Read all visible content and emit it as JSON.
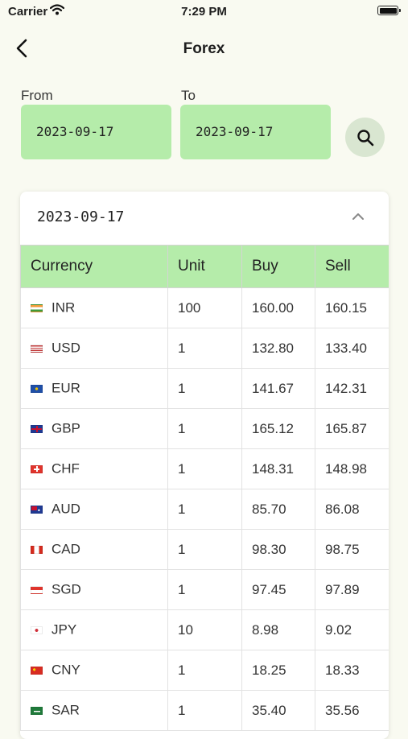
{
  "status": {
    "carrier": "Carrier",
    "time": "7:29 PM"
  },
  "nav": {
    "title": "Forex",
    "back_icon": "chevron-left-icon"
  },
  "filters": {
    "from_label": "From",
    "from_value": "2023-09-17",
    "to_label": "To",
    "to_value": "2023-09-17",
    "search_icon": "search-icon"
  },
  "card": {
    "date": "2023-09-17",
    "collapse_icon": "chevron-up-icon",
    "headers": [
      "Currency",
      "Unit",
      "Buy",
      "Sell"
    ],
    "rows": [
      {
        "code": "INR",
        "unit": "100",
        "buy": "160.00",
        "sell": "160.15",
        "flag": "india-flag-icon"
      },
      {
        "code": "USD",
        "unit": "1",
        "buy": "132.80",
        "sell": "133.40",
        "flag": "usa-flag-icon"
      },
      {
        "code": "EUR",
        "unit": "1",
        "buy": "141.67",
        "sell": "142.31",
        "flag": "eu-flag-icon"
      },
      {
        "code": "GBP",
        "unit": "1",
        "buy": "165.12",
        "sell": "165.87",
        "flag": "uk-flag-icon"
      },
      {
        "code": "CHF",
        "unit": "1",
        "buy": "148.31",
        "sell": "148.98",
        "flag": "switzerland-flag-icon"
      },
      {
        "code": "AUD",
        "unit": "1",
        "buy": "85.70",
        "sell": "86.08",
        "flag": "australia-flag-icon"
      },
      {
        "code": "CAD",
        "unit": "1",
        "buy": "98.30",
        "sell": "98.75",
        "flag": "canada-flag-icon"
      },
      {
        "code": "SGD",
        "unit": "1",
        "buy": "97.45",
        "sell": "97.89",
        "flag": "singapore-flag-icon"
      },
      {
        "code": "JPY",
        "unit": "10",
        "buy": "8.98",
        "sell": "9.02",
        "flag": "japan-flag-icon"
      },
      {
        "code": "CNY",
        "unit": "1",
        "buy": "18.25",
        "sell": "18.33",
        "flag": "china-flag-icon"
      },
      {
        "code": "SAR",
        "unit": "1",
        "buy": "35.40",
        "sell": "35.56",
        "flag": "saudi-flag-icon"
      }
    ]
  },
  "colors": {
    "accent_green": "#b5ecaa",
    "background": "#f9faf1",
    "search_button": "#d9e6d1"
  }
}
